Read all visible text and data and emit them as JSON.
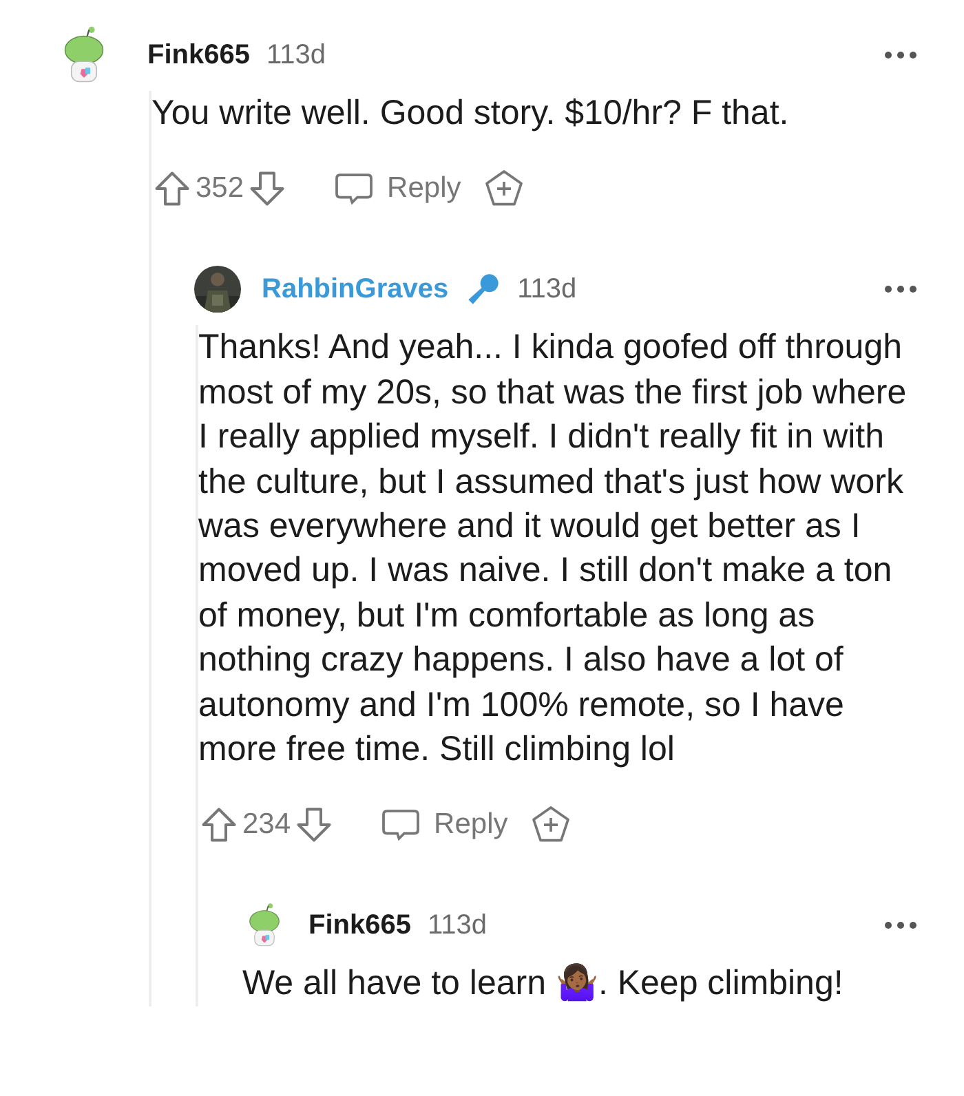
{
  "comments": [
    {
      "author": "Fink665",
      "avatar": {
        "kind": "snoo"
      },
      "flair_icon": false,
      "age": "113d",
      "body": "You write well. Good story. $10/hr? F that.",
      "score": "352",
      "reply_label": "Reply",
      "children": [
        {
          "author": "RahbinGraves",
          "flair_icon": true,
          "age": "113d",
          "body": "Thanks! And yeah... I kinda goofed off through most of my 20s, so that was the first job where I really applied myself. I didn't really fit in with the culture, but I assumed that's just how work was everywhere and it would get better as I moved up. I was naive. I still don't make a ton of money, but I'm comfortable as long as nothing crazy happens. I also have a lot of autonomy and I'm 100% remote, so I have more free time. Still climbing lol",
          "score": "234",
          "reply_label": "Reply",
          "children": [
            {
              "author": "Fink665",
              "avatar": {
                "kind": "snoo"
              },
              "flair_icon": false,
              "age": "113d",
              "body": "We all have to learn 🤷🏾‍♀️. Keep climbing!"
            }
          ]
        }
      ]
    }
  ]
}
